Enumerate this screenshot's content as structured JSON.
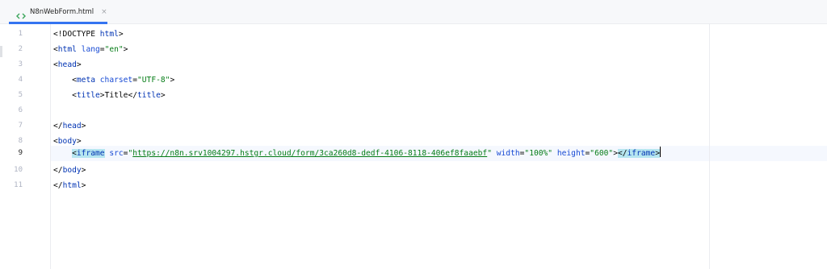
{
  "tab": {
    "label": "N8nWebForm.html",
    "close": "×",
    "icon": "html-file-icon"
  },
  "editor": {
    "active_line": 9,
    "lines": [
      {
        "number": "1"
      },
      {
        "number": "2"
      },
      {
        "number": "3"
      },
      {
        "number": "4"
      },
      {
        "number": "5"
      },
      {
        "number": "6"
      },
      {
        "number": "7"
      },
      {
        "number": "8"
      },
      {
        "number": "9"
      },
      {
        "number": "10"
      },
      {
        "number": "11"
      }
    ]
  },
  "code": {
    "l1": {
      "open": "<!DOCTYPE ",
      "kw": "html",
      "close": ">"
    },
    "l2": {
      "lt": "<",
      "tag": "html",
      "attr": " lang",
      "eq": "=",
      "val": "\"en\"",
      "gt": ">"
    },
    "l3": {
      "lt": "<",
      "tag": "head",
      "gt": ">"
    },
    "l4": {
      "indent": "    ",
      "lt": "<",
      "tag": "meta",
      "attr": " charset",
      "eq": "=",
      "val": "\"UTF-8\"",
      "gt": ">"
    },
    "l5": {
      "indent": "    ",
      "lt": "<",
      "tag": "title",
      "gt": ">",
      "text": "Title",
      "lt2": "</",
      "tag2": "title",
      "gt2": ">"
    },
    "l7": {
      "lt": "</",
      "tag": "head",
      "gt": ">"
    },
    "l8": {
      "lt": "<",
      "tag": "body",
      "gt": ">"
    },
    "l9": {
      "indent": "    ",
      "lt": "<",
      "tag": "iframe",
      "attr_src": " src",
      "eq1": "=",
      "q1": "\"",
      "url": "https://n8n.srv1004297.hstgr.cloud/form/3ca260d8-dedf-4106-8118-406ef8faaebf",
      "q2": "\"",
      "attr_width": " width",
      "eq2": "=",
      "val_width": "\"100%\"",
      "attr_height": " height",
      "eq3": "=",
      "val_height": "\"600\"",
      "gt": ">",
      "close_lt": "</",
      "close_tag": "iframe",
      "close_gt": ">"
    },
    "l10": {
      "lt": "</",
      "tag": "body",
      "gt": ">"
    },
    "l11": {
      "lt": "</",
      "tag": "html",
      "gt": ">"
    }
  },
  "colors": {
    "tag": "#0033b3",
    "attribute": "#174ad4",
    "string": "#067d17",
    "tab_accent": "#3574f0",
    "tag_match_highlight": "#b6e6f0"
  }
}
